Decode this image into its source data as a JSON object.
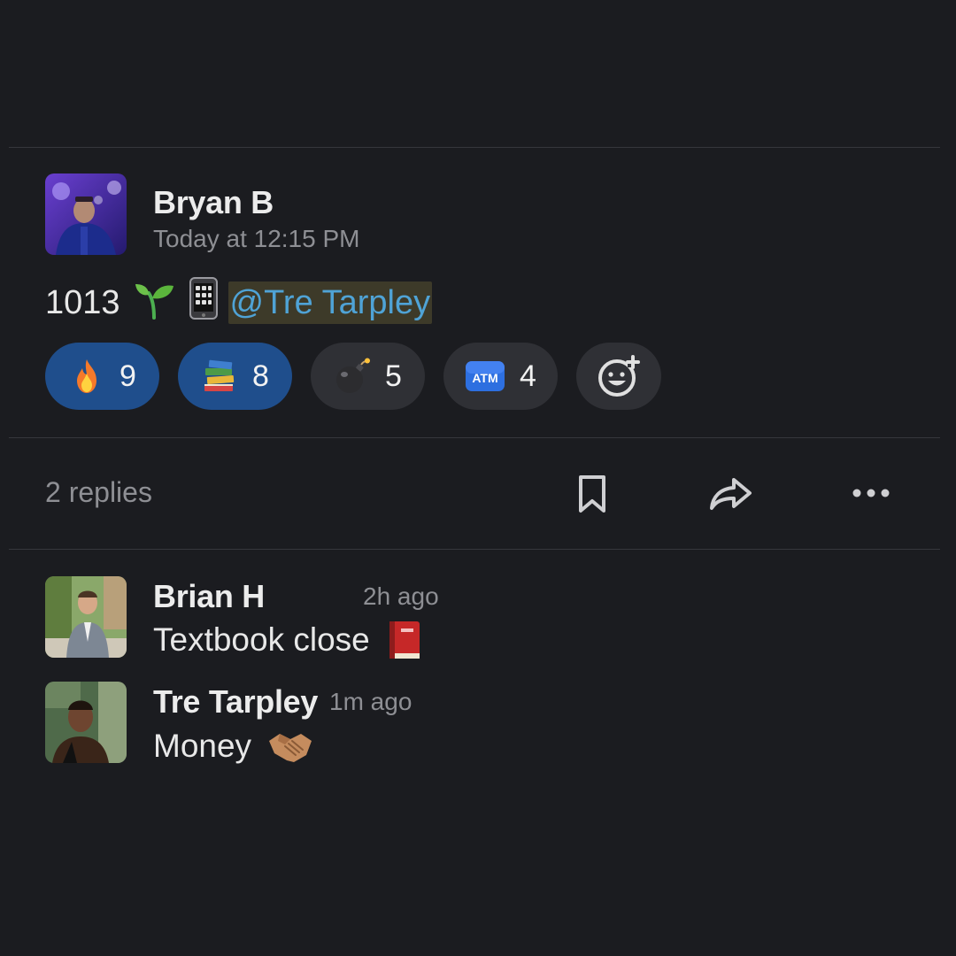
{
  "message": {
    "author": "Bryan B",
    "timestamp": "Today at 12:15 PM",
    "text": "1013",
    "emojis": [
      "seedling-icon",
      "mobile-phone-icon"
    ],
    "mention": "@Tre Tarpley"
  },
  "reactions": [
    {
      "icon": "fire-icon",
      "count": "9",
      "selected": true
    },
    {
      "icon": "books-icon",
      "count": "8",
      "selected": true
    },
    {
      "icon": "bomb-icon",
      "count": "5",
      "selected": false
    },
    {
      "icon": "atm-icon",
      "count": "4",
      "selected": false,
      "icon_label": "ATM"
    }
  ],
  "add_reaction": {
    "icon": "add-reaction-icon"
  },
  "thread": {
    "replies_label": "2 replies",
    "actions": [
      "bookmark-icon",
      "share-icon",
      "more-icon"
    ]
  },
  "replies": [
    {
      "author": "Brian H",
      "time": "2h ago",
      "text": "Textbook close",
      "emoji": "closed-book-icon"
    },
    {
      "author": "Tre Tarpley",
      "time": "1m ago",
      "text": "Money",
      "emoji": "handshake-icon"
    }
  ],
  "colors": {
    "background": "#1b1c20",
    "reaction_selected": "#1f4e8c",
    "reaction_plain": "#2f3035",
    "mention_text": "#4fa3d6",
    "mention_bg": "#3d3a29"
  }
}
